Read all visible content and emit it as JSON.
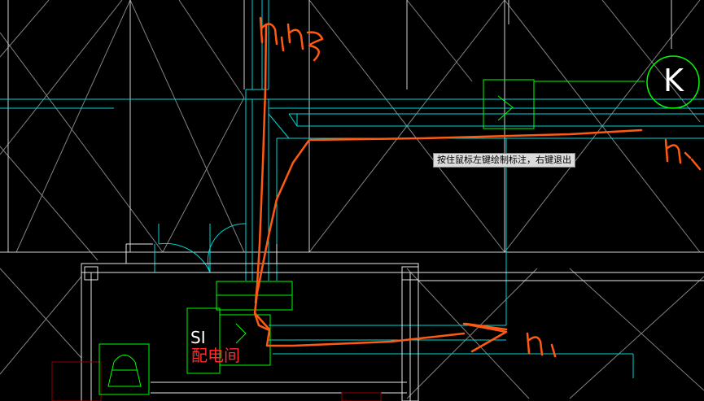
{
  "status": {
    "tooltip": "按住鼠标左键绘制标注，右键退出"
  },
  "labels": {
    "s1": "SI",
    "room": "配电间",
    "grid_axis": "K"
  },
  "annotations": {
    "n1": "n₁",
    "n2": "n₂",
    "n3": "n₃"
  },
  "colors": {
    "background": "#000000",
    "grid_lines": "#ffffff",
    "cyan_lines": "#00e5e5",
    "green_symbols": "#00ff00",
    "orange_markup": "#ff5a14",
    "red_text": "#ff2a2a",
    "dark_red": "#8b0000"
  },
  "icons": {
    "axis_bubble": "circle-k-icon",
    "equipment": "panel-box-icon"
  }
}
